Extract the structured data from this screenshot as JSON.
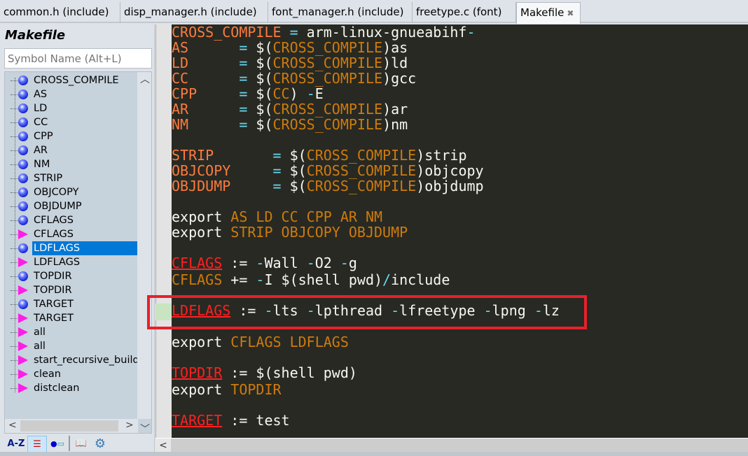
{
  "tabs": [
    {
      "label": "common.h (include)",
      "active": false
    },
    {
      "label": "disp_manager.h (include)",
      "active": false
    },
    {
      "label": "font_manager.h (include)",
      "active": false
    },
    {
      "label": "freetype.c (font)",
      "active": false
    },
    {
      "label": "Makefile",
      "active": true,
      "close": "✖"
    }
  ],
  "sidebar": {
    "title": "Makefile",
    "search_placeholder": "Symbol Name (Alt+L)",
    "items": [
      {
        "label": "CROSS_COMPILE",
        "icon": "variable"
      },
      {
        "label": "AS",
        "icon": "variable"
      },
      {
        "label": "LD",
        "icon": "variable"
      },
      {
        "label": "CC",
        "icon": "variable"
      },
      {
        "label": "CPP",
        "icon": "variable"
      },
      {
        "label": "AR",
        "icon": "variable"
      },
      {
        "label": "NM",
        "icon": "variable"
      },
      {
        "label": "STRIP",
        "icon": "variable"
      },
      {
        "label": "OBJCOPY",
        "icon": "variable"
      },
      {
        "label": "OBJDUMP",
        "icon": "variable"
      },
      {
        "label": "CFLAGS",
        "icon": "variable"
      },
      {
        "label": "CFLAGS",
        "icon": "rule"
      },
      {
        "label": "LDFLAGS",
        "icon": "variable",
        "selected": true
      },
      {
        "label": "LDFLAGS",
        "icon": "rule"
      },
      {
        "label": "TOPDIR",
        "icon": "variable"
      },
      {
        "label": "TOPDIR",
        "icon": "rule"
      },
      {
        "label": "TARGET",
        "icon": "variable"
      },
      {
        "label": "TARGET",
        "icon": "rule"
      },
      {
        "label": "all",
        "icon": "rule"
      },
      {
        "label": "all",
        "icon": "rule"
      },
      {
        "label": "start_recursive_build",
        "icon": "rule"
      },
      {
        "label": "clean",
        "icon": "rule"
      },
      {
        "label": "distclean",
        "icon": "rule"
      }
    ],
    "tools": {
      "az": "A-Z"
    }
  },
  "colors": {
    "editor_bg": "#282923",
    "highlight_box": "#e8202a",
    "selection": "#0078d7"
  },
  "code": [
    [
      [
        "var",
        "CROSS_COMPILE"
      ],
      [
        "txt",
        " "
      ],
      [
        "op",
        "="
      ],
      [
        "txt",
        " arm-linux-gnueabihf"
      ],
      [
        "op",
        "-"
      ]
    ],
    [
      [
        "var",
        "AS"
      ],
      [
        "txt",
        "      "
      ],
      [
        "op",
        "="
      ],
      [
        "txt",
        " $("
      ],
      [
        "ref",
        "CROSS_COMPILE"
      ],
      [
        "txt",
        ")as"
      ]
    ],
    [
      [
        "var",
        "LD"
      ],
      [
        "txt",
        "      "
      ],
      [
        "op",
        "="
      ],
      [
        "txt",
        " $("
      ],
      [
        "ref",
        "CROSS_COMPILE"
      ],
      [
        "txt",
        ")ld"
      ]
    ],
    [
      [
        "var",
        "CC"
      ],
      [
        "txt",
        "      "
      ],
      [
        "op",
        "="
      ],
      [
        "txt",
        " $("
      ],
      [
        "ref",
        "CROSS_COMPILE"
      ],
      [
        "txt",
        ")gcc"
      ]
    ],
    [
      [
        "var",
        "CPP"
      ],
      [
        "txt",
        "     "
      ],
      [
        "op",
        "="
      ],
      [
        "txt",
        " $("
      ],
      [
        "ref",
        "CC"
      ],
      [
        "txt",
        ") "
      ],
      [
        "op",
        "-"
      ],
      [
        "txt",
        "E"
      ]
    ],
    [
      [
        "var",
        "AR"
      ],
      [
        "txt",
        "      "
      ],
      [
        "op",
        "="
      ],
      [
        "txt",
        " $("
      ],
      [
        "ref",
        "CROSS_COMPILE"
      ],
      [
        "txt",
        ")ar"
      ]
    ],
    [
      [
        "var",
        "NM"
      ],
      [
        "txt",
        "      "
      ],
      [
        "op",
        "="
      ],
      [
        "txt",
        " $("
      ],
      [
        "ref",
        "CROSS_COMPILE"
      ],
      [
        "txt",
        ")nm"
      ]
    ],
    [],
    [
      [
        "var",
        "STRIP"
      ],
      [
        "txt",
        "       "
      ],
      [
        "op",
        "="
      ],
      [
        "txt",
        " $("
      ],
      [
        "ref",
        "CROSS_COMPILE"
      ],
      [
        "txt",
        ")strip"
      ]
    ],
    [
      [
        "var",
        "OBJCOPY"
      ],
      [
        "txt",
        "     "
      ],
      [
        "op",
        "="
      ],
      [
        "txt",
        " $("
      ],
      [
        "ref",
        "CROSS_COMPILE"
      ],
      [
        "txt",
        ")objcopy"
      ]
    ],
    [
      [
        "var",
        "OBJDUMP"
      ],
      [
        "txt",
        "     "
      ],
      [
        "op",
        "="
      ],
      [
        "txt",
        " $("
      ],
      [
        "ref",
        "CROSS_COMPILE"
      ],
      [
        "txt",
        ")objdump"
      ]
    ],
    [],
    [
      [
        "txt",
        "export "
      ],
      [
        "ref",
        "AS LD CC CPP AR NM"
      ]
    ],
    [
      [
        "txt",
        "export "
      ],
      [
        "ref",
        "STRIP OBJCOPY OBJDUMP"
      ]
    ],
    [],
    [
      [
        "def",
        "CFLAGS"
      ],
      [
        "txt",
        " := "
      ],
      [
        "op",
        "-"
      ],
      [
        "txt",
        "Wall "
      ],
      [
        "op",
        "-"
      ],
      [
        "txt",
        "O2 "
      ],
      [
        "op",
        "-"
      ],
      [
        "txt",
        "g"
      ]
    ],
    [
      [
        "ref",
        "CFLAGS"
      ],
      [
        "txt",
        " += "
      ],
      [
        "op",
        "-"
      ],
      [
        "txt",
        "I $(shell pwd)"
      ],
      [
        "op",
        "/"
      ],
      [
        "txt",
        "include"
      ]
    ],
    [],
    [
      [
        "def",
        "LDFLAGS"
      ],
      [
        "txt",
        " := "
      ],
      [
        "op",
        "-"
      ],
      [
        "txt",
        "lts "
      ],
      [
        "op",
        "-"
      ],
      [
        "txt",
        "lpthread "
      ],
      [
        "op",
        "-"
      ],
      [
        "txt",
        "lfreetype "
      ],
      [
        "op",
        "-"
      ],
      [
        "txt",
        "lpng "
      ],
      [
        "op",
        "-"
      ],
      [
        "txt",
        "lz"
      ]
    ],
    [],
    [
      [
        "txt",
        "export "
      ],
      [
        "ref",
        "CFLAGS LDFLAGS"
      ]
    ],
    [],
    [
      [
        "def",
        "TOPDIR"
      ],
      [
        "txt",
        " := $(shell pwd)"
      ]
    ],
    [
      [
        "txt",
        "export "
      ],
      [
        "ref",
        "TOPDIR"
      ]
    ],
    [],
    [
      [
        "def",
        "TARGET"
      ],
      [
        "txt",
        " := test"
      ]
    ]
  ]
}
